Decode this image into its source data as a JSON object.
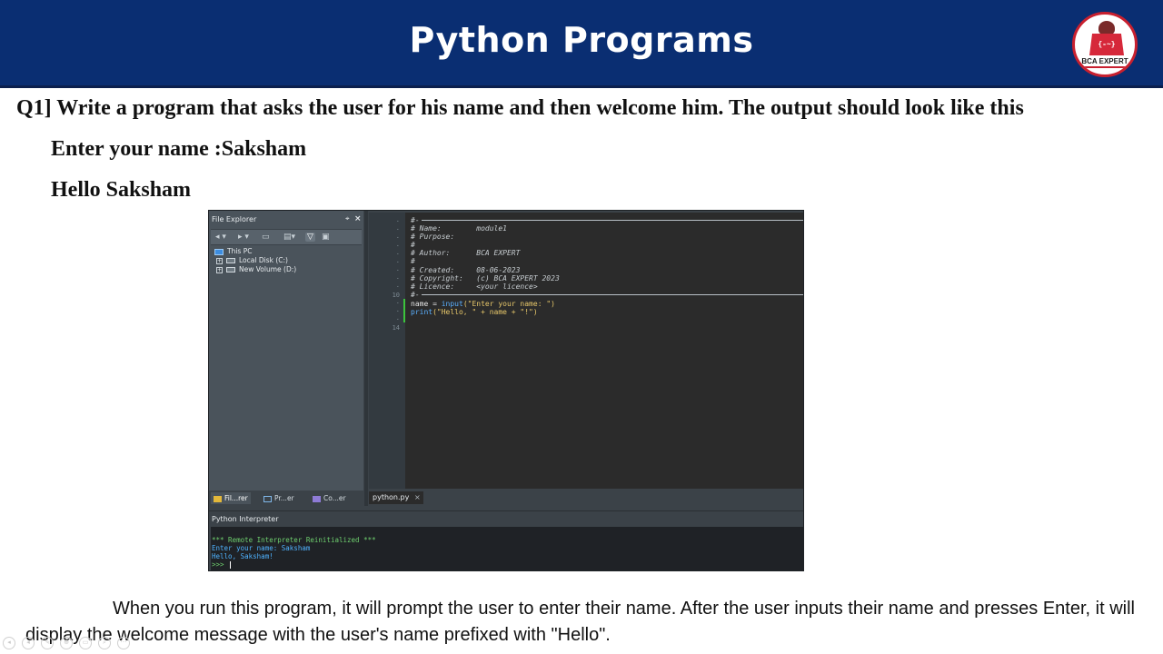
{
  "header": {
    "title": "Python Programs",
    "logo_text": "BCA EXPERT",
    "logo_code": "{-~}",
    "bg_color": "#0a2e72"
  },
  "question": {
    "text": "Q1] Write a program that asks the user for his name and then welcome him. The output should look like this",
    "output_line1": "Enter your name :Saksham",
    "output_line2": "Hello Saksham"
  },
  "ide": {
    "file_explorer": {
      "title": "File Explorer",
      "pin_icon": "pin-icon",
      "close_label": "×",
      "toolbar_icons": [
        "back-icon",
        "forward-icon",
        "folder-open-icon",
        "tree-view-icon",
        "filter-icon",
        "settings-icon"
      ],
      "tree": [
        {
          "label": "This PC",
          "icon": "computer-icon"
        },
        {
          "label": "Local Disk (C:)",
          "icon": "drive-icon"
        },
        {
          "label": "New Volume (D:)",
          "icon": "drive-icon"
        }
      ],
      "bottom_tabs": [
        {
          "label": "Fil...rer",
          "icon": "file-explorer-icon"
        },
        {
          "label": "Pr...er",
          "icon": "project-explorer-icon"
        },
        {
          "label": "Co...er",
          "icon": "code-explorer-icon"
        }
      ]
    },
    "editor": {
      "line_numbers": {
        "line10": "10",
        "line14": "14"
      },
      "header_comments": [
        "#-",
        "# Name:        module1",
        "# Purpose:",
        "#",
        "# Author:      BCA EXPERT",
        "#",
        "# Created:     08-06-2023",
        "# Copyright:   (c) BCA EXPERT 2023",
        "# Licence:     <your licence>",
        "#-"
      ],
      "code": {
        "line1_var": "name",
        "line1_op": " = ",
        "line1_fn": "input",
        "line1_str": "(\"Enter your name: \")",
        "line2_fn": "print",
        "line2_str": "(\"Hello, \" + name + \"!\")"
      },
      "tab_label": "python.py",
      "tab_close": "×"
    },
    "interpreter": {
      "title": "Python Interpreter",
      "lines": [
        "*** Remote Interpreter Reinitialized ***",
        "Enter your name: Saksham",
        "Hello, Saksham!",
        ">>> "
      ]
    }
  },
  "paragraph": "When you run this program, it will prompt the user to enter their name. After the user inputs their name and presses Enter, it will display the welcome message with the user's name prefixed with \"Hello\"."
}
